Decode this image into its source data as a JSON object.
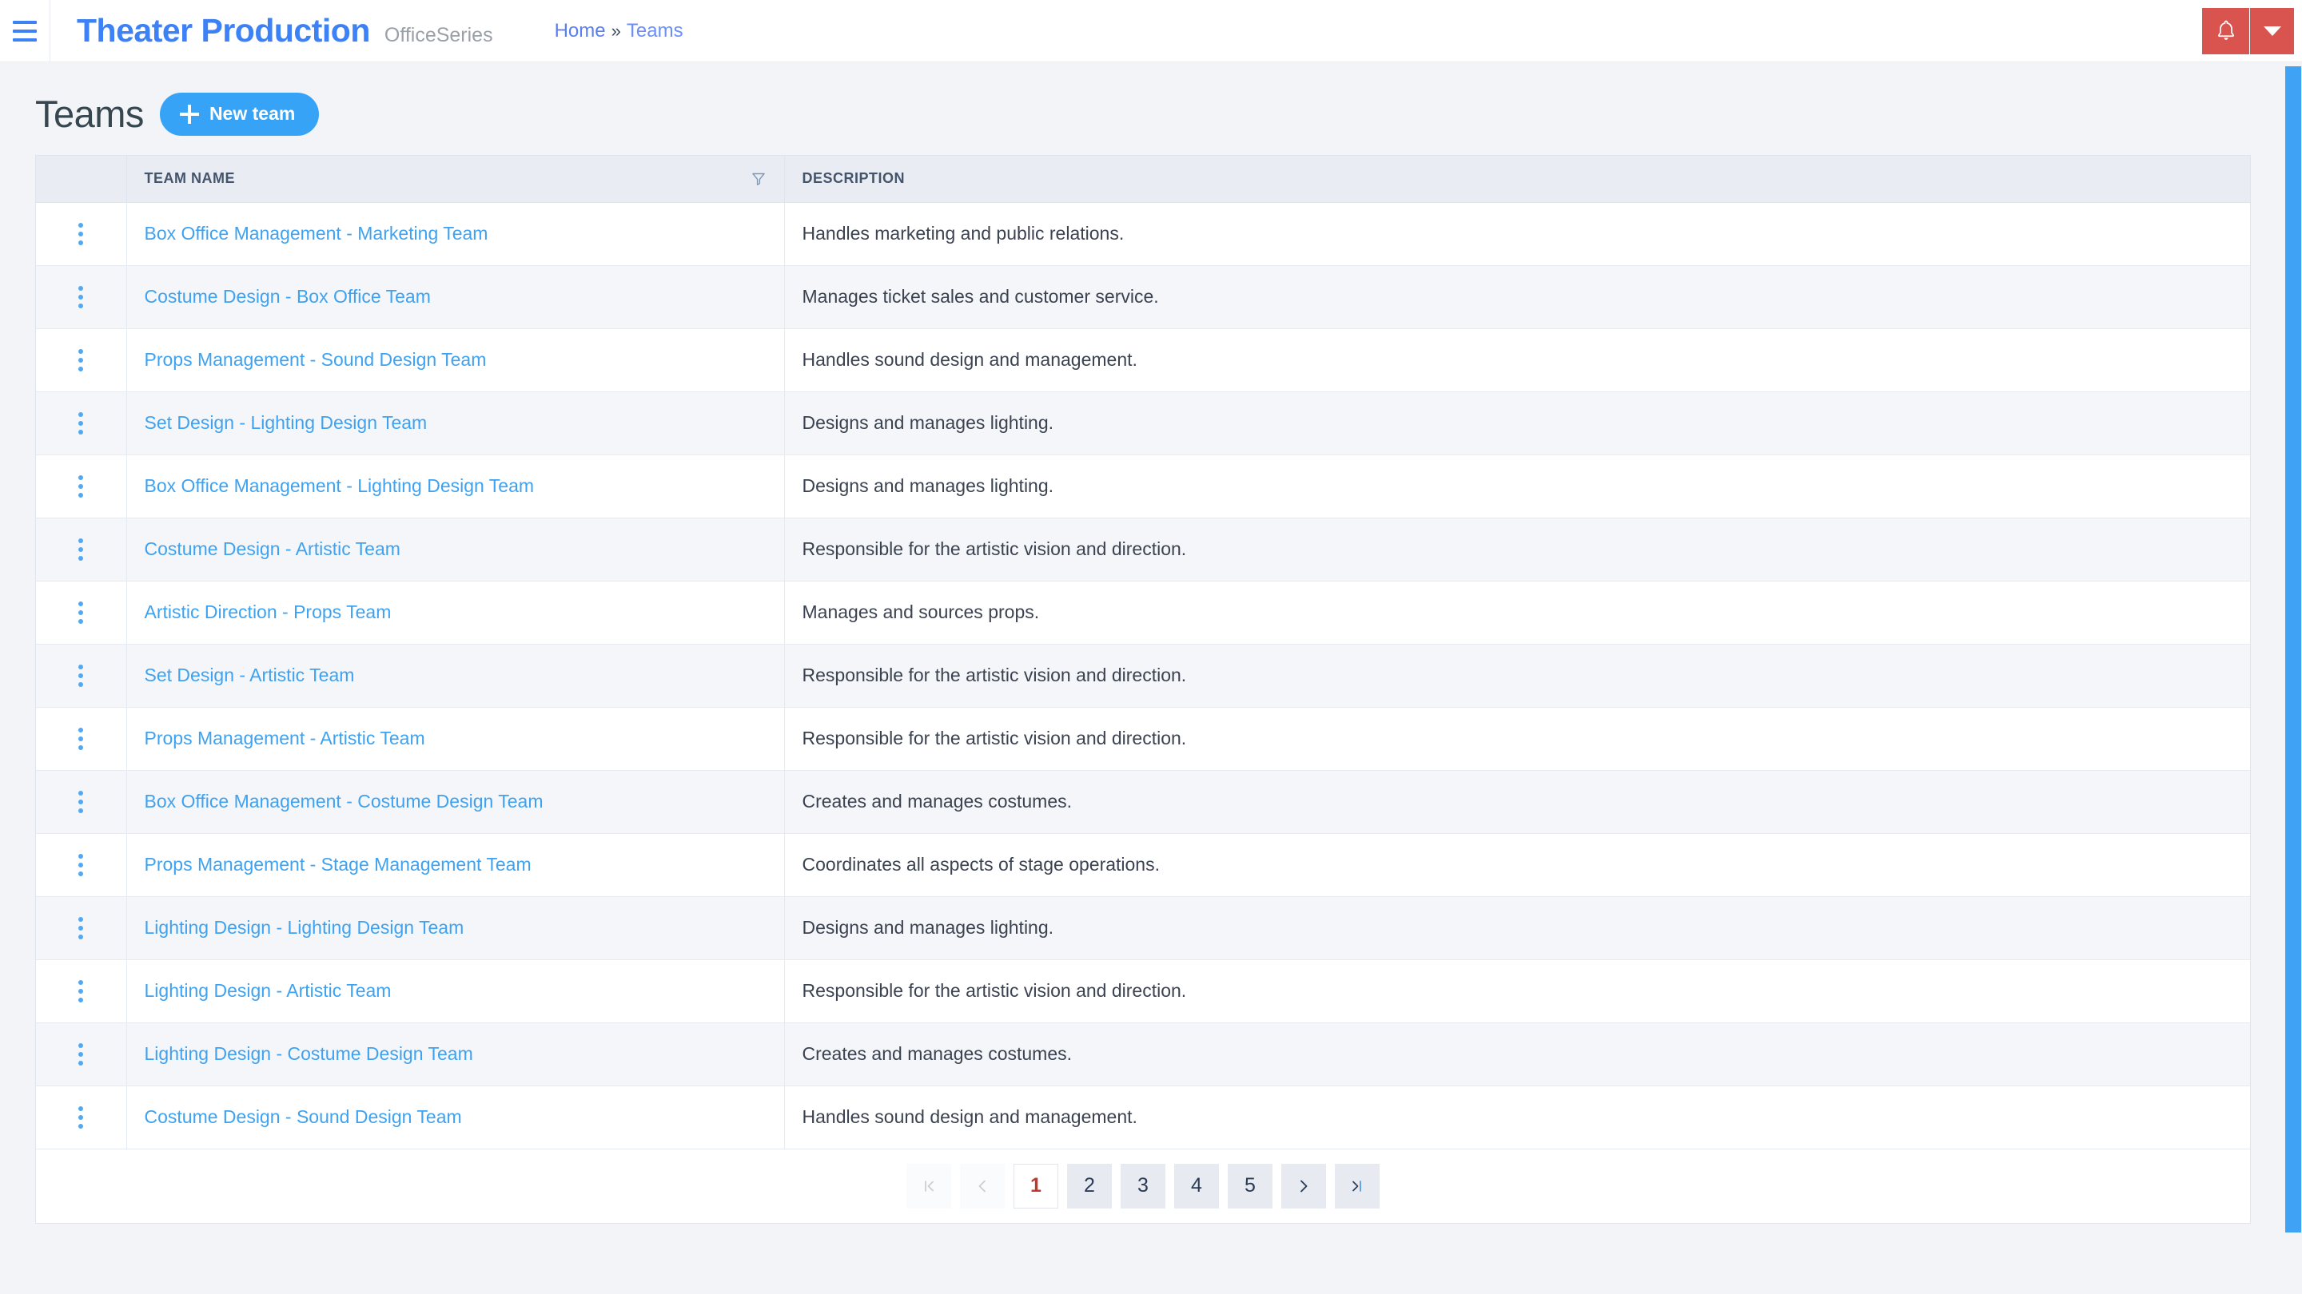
{
  "navbar": {
    "menu_icon": "hamburger-icon",
    "brand_title": "Theater Production",
    "brand_subtitle": "OfficeSeries",
    "breadcrumb": {
      "home_label": "Home",
      "separator": "»",
      "current_label": "Teams"
    },
    "notification_icon": "bell-icon",
    "notification_caret_icon": "chevron-down-icon",
    "notification_color": "#d9534f"
  },
  "page": {
    "title": "Teams",
    "new_button_label": "New team",
    "new_button_icon": "plus-icon",
    "accent_color": "#37a3f7"
  },
  "table": {
    "columns": [
      {
        "key": "actions",
        "label": ""
      },
      {
        "key": "name",
        "label": "TEAM NAME",
        "filter_icon": "filter-funnel-icon"
      },
      {
        "key": "description",
        "label": "DESCRIPTION"
      }
    ],
    "row_menu_icon": "kebab-menu-icon",
    "rows": [
      {
        "name": "Box Office Management - Marketing Team",
        "description": "Handles marketing and public relations."
      },
      {
        "name": "Costume Design - Box Office Team",
        "description": "Manages ticket sales and customer service."
      },
      {
        "name": "Props Management - Sound Design Team",
        "description": "Handles sound design and management."
      },
      {
        "name": "Set Design - Lighting Design Team",
        "description": "Designs and manages lighting."
      },
      {
        "name": "Box Office Management - Lighting Design Team",
        "description": "Designs and manages lighting."
      },
      {
        "name": "Costume Design - Artistic Team",
        "description": "Responsible for the artistic vision and direction."
      },
      {
        "name": "Artistic Direction - Props Team",
        "description": "Manages and sources props."
      },
      {
        "name": "Set Design - Artistic Team",
        "description": "Responsible for the artistic vision and direction."
      },
      {
        "name": "Props Management - Artistic Team",
        "description": "Responsible for the artistic vision and direction."
      },
      {
        "name": "Box Office Management - Costume Design Team",
        "description": "Creates and manages costumes."
      },
      {
        "name": "Props Management - Stage Management Team",
        "description": "Coordinates all aspects of stage operations."
      },
      {
        "name": "Lighting Design - Lighting Design Team",
        "description": "Designs and manages lighting."
      },
      {
        "name": "Lighting Design - Artistic Team",
        "description": "Responsible for the artistic vision and direction."
      },
      {
        "name": "Lighting Design - Costume Design Team",
        "description": "Creates and manages costumes."
      },
      {
        "name": "Costume Design - Sound Design Team",
        "description": "Handles sound design and management."
      }
    ]
  },
  "pagination": {
    "first_icon": "first-page-icon",
    "prev_icon": "previous-page-icon",
    "next_icon": "next-page-icon",
    "last_icon": "last-page-icon",
    "pages": [
      "1",
      "2",
      "3",
      "4",
      "5"
    ],
    "active_page": "1",
    "first_disabled": true,
    "prev_disabled": true,
    "active_color": "#c0392b"
  },
  "scrollbar": {
    "name": "vertical-scrollbar",
    "color": "#3fa2f5"
  }
}
